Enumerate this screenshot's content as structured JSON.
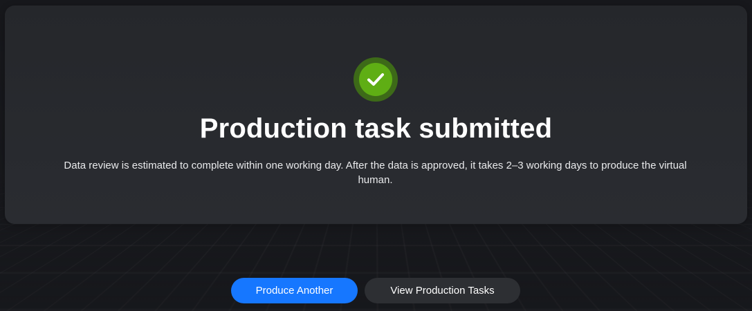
{
  "result": {
    "icon": "check-circle-icon",
    "title": "Production task submitted",
    "description": "Data review is estimated to complete within one working day. After the data is approved, it takes 2–3 working days to produce the virtual human."
  },
  "actions": {
    "primary_label": "Produce Another",
    "secondary_label": "View Production Tasks"
  },
  "colors": {
    "success": "#5fae14",
    "primary": "#1677ff",
    "background": "#17181c",
    "card": "#27292d"
  }
}
